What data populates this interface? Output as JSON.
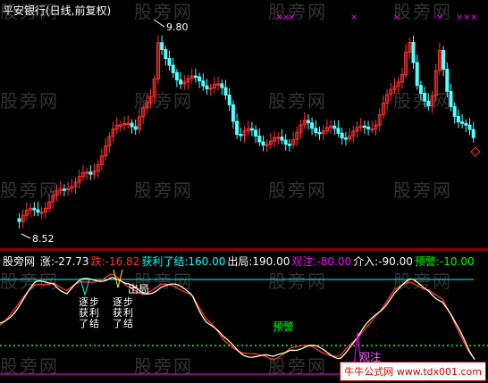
{
  "upper": {
    "title": "平安银行(日线,前复权)",
    "high_label": "9.80",
    "low_label": "8.52"
  },
  "lower": {
    "indicator_name": "股旁网",
    "legend": [
      {
        "label": "涨:",
        "value": "-27.73",
        "color": "#ffffff"
      },
      {
        "label": "跌:",
        "value": "-16.82",
        "color": "#ff3333"
      },
      {
        "label": "获利了结:",
        "value": "160.00",
        "color": "#00ffff"
      },
      {
        "label": "出局:",
        "value": "190.00",
        "color": "#ffffff"
      },
      {
        "label": "观注:",
        "value": "-80.00",
        "color": "#ff00ff"
      },
      {
        "label": "介入:",
        "value": "-90.00",
        "color": "#ffffff"
      },
      {
        "label": "预警:",
        "value": "-10.00",
        "color": "#00ff00"
      }
    ],
    "annotations": {
      "step1": "逐步获利了结",
      "step2": "逐步获利了结",
      "exit": "出局",
      "warn": "预警",
      "watch": "观注"
    }
  },
  "watermark": "股旁网",
  "logo_text": "牛牛公式网 www.tdx001.com",
  "colors": {
    "up": "#ff3333",
    "down": "#54ffff",
    "bg": "#000000",
    "line_white": "#ffffff",
    "line_red": "#ff3333"
  }
}
